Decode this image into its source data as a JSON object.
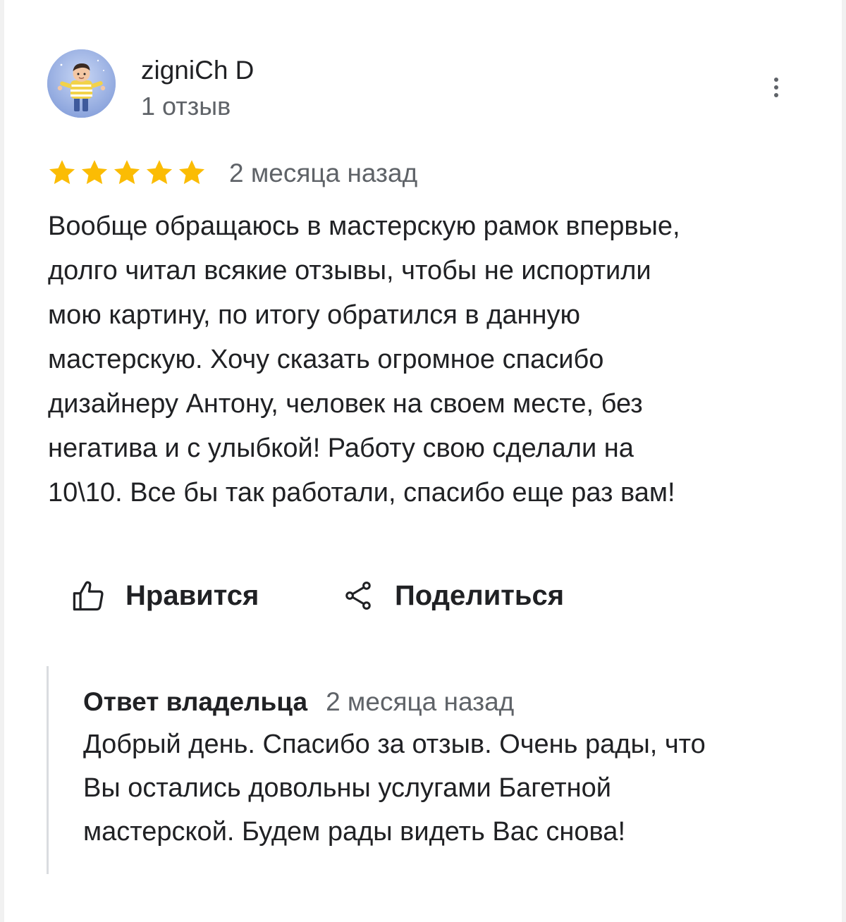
{
  "review": {
    "author": {
      "name": "zigniCh D",
      "reviews_count": "1 отзыв",
      "avatar": "cartoon-boy-avatar"
    },
    "menu_icon": "more-vert-icon",
    "rating": 5,
    "rating_max": 5,
    "star_color": "#FBBC04",
    "date": "2 месяца назад",
    "text": "Вообще обращаюсь в мастерскую рамок впервые,\nдолго читал всякие отзывы, чтобы не испортили\nмою картину, по итогу обратился в данную\nмастерскую. Хочу сказать огромное спасибо\nдизайнеру Антону, человек на своем месте, без\nнегатива и с улыбкой! Работу свою сделали на\n10\\10. Все бы так работали, спасибо еще раз вам!"
  },
  "actions": {
    "like": {
      "label": "Нравится",
      "icon": "thumb-up-icon"
    },
    "share": {
      "label": "Поделиться",
      "icon": "share-icon"
    }
  },
  "owner_reply": {
    "title": "Ответ владельца",
    "date": "2 месяца назад",
    "text": "Добрый день. Спасибо за отзыв. Очень рады, что\nВы остались довольны услугами Багетной\nмастерской. Будем рады видеть Вас снова!"
  }
}
